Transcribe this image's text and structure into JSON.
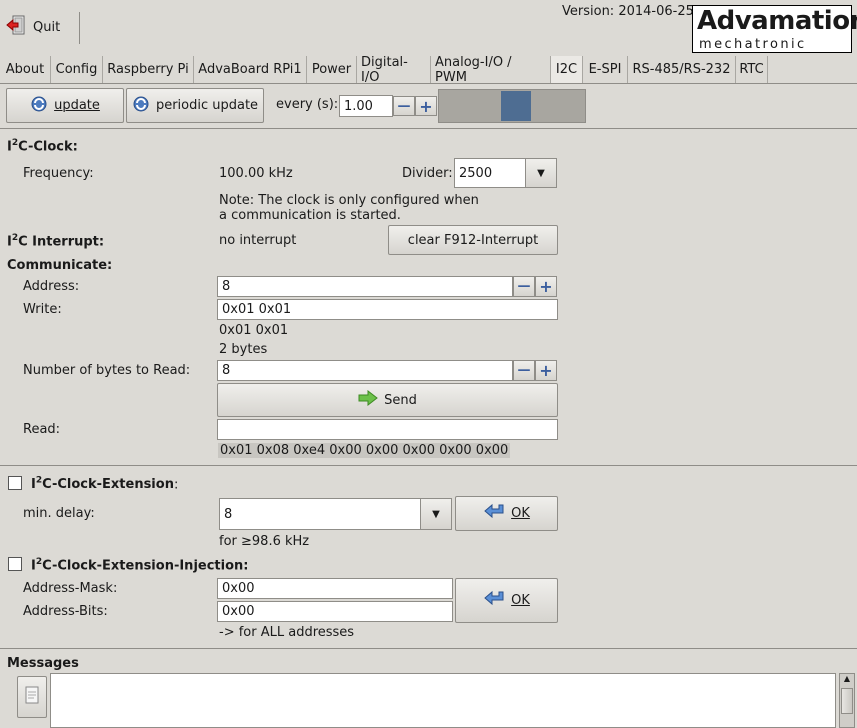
{
  "toolbar": {
    "quit_label": "Quit",
    "version": "Version: 2014-06-25"
  },
  "logo": {
    "line1": "Advamation",
    "line2": "mechatronic"
  },
  "tabs": [
    "About",
    "Config",
    "Raspberry Pi",
    "AdvaBoard RPi1",
    "Power",
    "Digital-I/O",
    "Analog-I/O / PWM",
    "I2C",
    "E-SPI",
    "RS-485/RS-232",
    "RTC"
  ],
  "active_tab": "I2C",
  "controls": {
    "update_label": "update",
    "periodic_update_label": "periodic update",
    "every_label": "every (s):",
    "every_value": "1.00"
  },
  "clock": {
    "heading": "I2C-Clock:",
    "frequency_label": "Frequency:",
    "frequency_value": "100.00 kHz",
    "divider_label": "Divider:",
    "divider_value": "2500",
    "note_line1": "Note: The clock is only configured when",
    "note_line2": "a communication is started."
  },
  "interrupt": {
    "heading": "I2C Interrupt:",
    "status": "no interrupt",
    "clear_button": "clear F912-Interrupt"
  },
  "communicate": {
    "heading": "Communicate:",
    "address_label": "Address:",
    "address_value": "8",
    "write_label": "Write:",
    "write_value": "0x01 0x01",
    "write_echo": "0x01 0x01",
    "write_bytes": "2 bytes",
    "nread_label": "Number of bytes to Read:",
    "nread_value": "8",
    "send_label": "Send",
    "read_label": "Read:",
    "read_value": "",
    "read_result": "0x01 0x08 0xe4 0x00 0x00 0x00 0x00 0x00"
  },
  "extension": {
    "heading": "I2C-Clock-Extension",
    "min_delay_label": "min. delay:",
    "min_delay_value": "8",
    "freq_note": "for ≥98.6 kHz",
    "ok_label": "OK"
  },
  "injection": {
    "heading": "I2C-Clock-Extension-Injection:",
    "mask_label": "Address-Mask:",
    "mask_value": "0x00",
    "bits_label": "Address-Bits:",
    "bits_value": "0x00",
    "note": "-> for ALL addresses",
    "ok_label": "OK"
  },
  "messages": {
    "heading": "Messages"
  }
}
